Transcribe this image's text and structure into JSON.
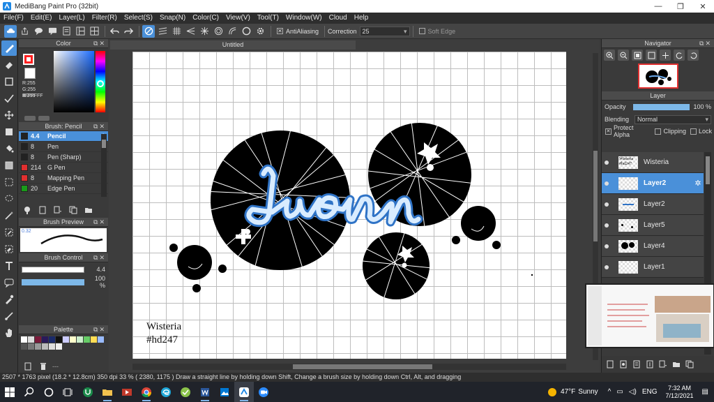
{
  "window": {
    "title": "MediBang Paint Pro (32bit)",
    "minimize_icon": "—",
    "maximize_icon": "❐",
    "close_icon": "✕"
  },
  "menu": [
    "File(F)",
    "Edit(E)",
    "Layer(L)",
    "Filter(R)",
    "Select(S)",
    "Snap(N)",
    "Color(C)",
    "View(V)",
    "Tool(T)",
    "Window(W)",
    "Cloud",
    "Help"
  ],
  "toolbar": {
    "antialiasing_label": "AntiAliasing",
    "correction_label": "Correction",
    "correction_value": "25",
    "soft_edge_label": "Soft Edge"
  },
  "color_panel": {
    "title": "Color",
    "fg_color": "#ff2020",
    "r_text": "R:255",
    "g_text": "G:255",
    "b_text": "B:255",
    "hex_text": "#FFFFFF"
  },
  "brush_panel": {
    "title": "Brush: Pencil",
    "brushes": [
      {
        "size": "4.4",
        "name": "Pencil",
        "color": "#222222",
        "active": true
      },
      {
        "size": "8",
        "name": "Pen",
        "color": "#222222",
        "active": false
      },
      {
        "size": "8",
        "name": "Pen (Sharp)",
        "color": "#222222",
        "active": false
      },
      {
        "size": "214",
        "name": "G Pen",
        "color": "#e03030",
        "active": false
      },
      {
        "size": "8",
        "name": "Mapping Pen",
        "color": "#e03030",
        "active": false
      },
      {
        "size": "20",
        "name": "Edge Pen",
        "color": "#1a9a1a",
        "active": false
      }
    ]
  },
  "brush_preview": {
    "title": "Brush Preview",
    "value": "0.32"
  },
  "brush_control": {
    "title": "Brush Control",
    "size_value": "4.4",
    "opacity_value": "100 %"
  },
  "palette": {
    "title": "Palette",
    "colors": [
      "#ffffff",
      "#dddddd",
      "#7a1a3a",
      "#2a1a5a",
      "#1a2a6a",
      "#111111",
      "#ccccff",
      "#ffffcc",
      "#cceecc",
      "#66cc66",
      "#ffdd55",
      "#99bbff",
      "#555555",
      "#777777",
      "#999999",
      "#bbbbbb",
      "#dddddd",
      "#eeeeee"
    ],
    "footer_text": "---"
  },
  "document": {
    "tab_title": "Untitled",
    "watermark_line1": "Wisteria",
    "watermark_line2": "#hd247"
  },
  "navigator": {
    "title": "Navigator"
  },
  "layer_panel": {
    "title": "Layer",
    "opacity_label": "Opacity",
    "opacity_value": "100 %",
    "blending_label": "Blending",
    "blending_value": "Normal",
    "protect_alpha_label": "Protect Alpha",
    "clipping_label": "Clipping",
    "lock_label": "Lock",
    "layers": [
      {
        "name": "Wisteria",
        "thumb_text": "Wisteria #hd247",
        "active": false
      },
      {
        "name": "Layer2",
        "thumb_text": "",
        "active": true
      },
      {
        "name": "Layer2",
        "thumb_text": "",
        "active": false
      },
      {
        "name": "Layer5",
        "thumb_text": "",
        "active": false
      },
      {
        "name": "Layer4",
        "thumb_text": "",
        "active": false
      },
      {
        "name": "Layer1",
        "thumb_text": "",
        "active": false
      }
    ]
  },
  "status": {
    "text": "2507 * 1763 pixel  (18.2 * 12.8cm)  350 dpi  33 %  ( 2380, 1175 )  Draw a straight line by holding down Shift, Change a brush size by holding down Ctrl, Alt, and dragging"
  },
  "taskbar": {
    "weather_temp": "47°F",
    "weather_text": "Sunny",
    "lang": "ENG",
    "time": "7:32 AM",
    "date": "7/12/2021"
  }
}
